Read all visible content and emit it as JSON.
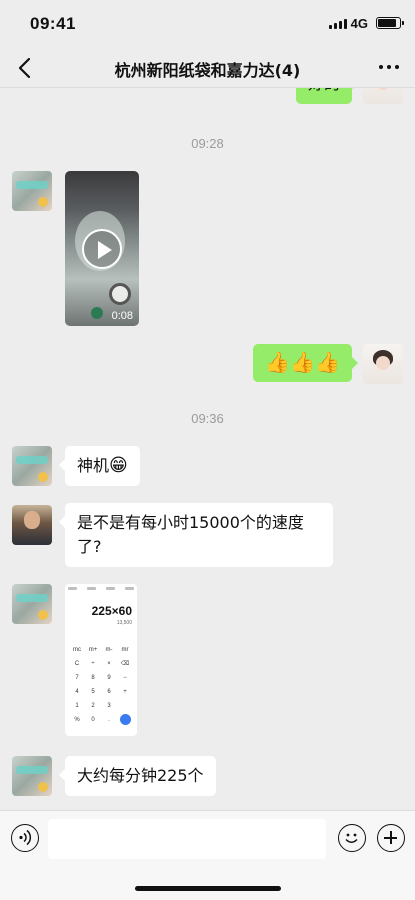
{
  "status_bar": {
    "time": "09:41",
    "network": "4G",
    "battery_level": 0.85
  },
  "header": {
    "title": "杭州新阳纸袋和嘉力达(4)"
  },
  "messages": [
    {
      "kind": "text",
      "side": "out",
      "text": "好的",
      "avatar": "avatar-self"
    },
    {
      "kind": "time",
      "text": "09:28"
    },
    {
      "kind": "video",
      "side": "in",
      "duration": "0:08",
      "avatar": "avatar-member-a"
    },
    {
      "kind": "emoji",
      "side": "out",
      "emoji": "thumbs-up x3",
      "avatar": "avatar-self"
    },
    {
      "kind": "time",
      "text": "09:36"
    },
    {
      "kind": "text",
      "side": "in",
      "text": "神机",
      "emoji": "grin",
      "avatar": "avatar-member-a"
    },
    {
      "kind": "text",
      "side": "in",
      "text": "是不是有每小时15000个的速度了?",
      "avatar": "avatar-member-b"
    },
    {
      "kind": "image",
      "side": "in",
      "image": "calculator-screenshot",
      "calc_expression": "225×60",
      "calc_result": "13,500",
      "avatar": "avatar-member-a"
    },
    {
      "kind": "text",
      "side": "in",
      "text": "大约每分钟225个",
      "avatar": "avatar-member-a"
    }
  ],
  "input_bar": {
    "placeholder": ""
  },
  "icons": {
    "back": "chevron-left-icon",
    "more": "more-dots-icon",
    "voice": "voice-icon",
    "emoji": "emoji-icon",
    "plus": "plus-icon"
  },
  "colors": {
    "background": "#ededed",
    "bubble_in": "#ffffff",
    "bubble_out": "#95ec69",
    "timestamp": "#9b9b9b"
  }
}
